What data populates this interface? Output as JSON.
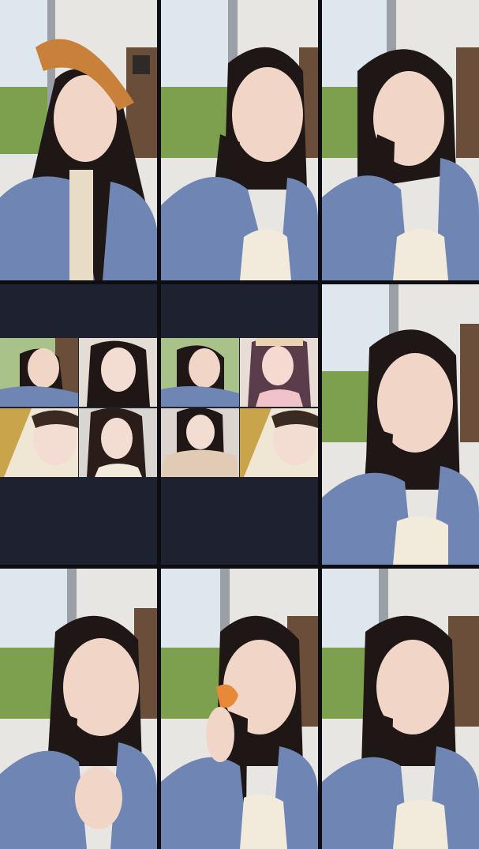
{
  "layout": {
    "rows": 3,
    "cols": 3
  },
  "colors": {
    "background": "#0e0e12",
    "dark_panel": "#1d2130",
    "shirt_blue": "#6f86b4",
    "hair": "#1f1715",
    "skin": "#f1d6c8",
    "wall": "#e8e6e2",
    "grass": "#7da04e",
    "sky": "#dfe7ee"
  },
  "tiles": [
    {
      "id": 1,
      "kind": "video",
      "subject": "girl-with-orange-headband"
    },
    {
      "id": 2,
      "kind": "video",
      "subject": "girl-with-braid"
    },
    {
      "id": 3,
      "kind": "video",
      "subject": "girl-with-braid-eyes-closed"
    },
    {
      "id": 4,
      "kind": "multi-call",
      "subject": "four-participant-grid"
    },
    {
      "id": 5,
      "kind": "multi-call",
      "subject": "four-participant-grid"
    },
    {
      "id": 6,
      "kind": "video",
      "subject": "girl-with-braid-close"
    },
    {
      "id": 7,
      "kind": "video",
      "subject": "girl-hands-clasped"
    },
    {
      "id": 8,
      "kind": "video",
      "subject": "girl-holding-clip"
    },
    {
      "id": 9,
      "kind": "video",
      "subject": "girl-with-braid-smiling"
    }
  ]
}
